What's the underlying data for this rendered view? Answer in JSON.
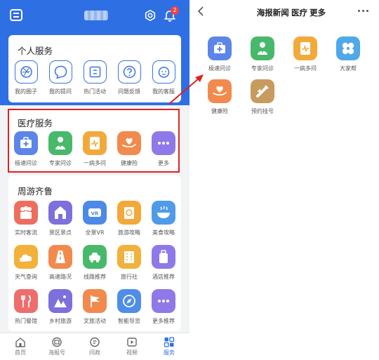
{
  "left_screen": {
    "notification_count": "2",
    "personal_services": {
      "title": "个人服务",
      "items": [
        {
          "label": "我的圈子",
          "icon": "camera-shutter-icon"
        },
        {
          "label": "我的提问",
          "icon": "chat-bubble-icon"
        },
        {
          "label": "热门活动",
          "icon": "ticket-icon"
        },
        {
          "label": "问题反馈",
          "icon": "question-mark-icon"
        },
        {
          "label": "我的客服",
          "icon": "customer-service-icon"
        }
      ]
    },
    "medical_services": {
      "title": "医疗服务",
      "items": [
        {
          "label": "极速问诊",
          "icon": "first-aid-kit-icon",
          "color": "#5b85e8"
        },
        {
          "label": "专家问诊",
          "icon": "doctor-icon",
          "color": "#48b96b"
        },
        {
          "label": "一病多问",
          "icon": "medical-report-icon",
          "color": "#f3a93a"
        },
        {
          "label": "健康险",
          "icon": "hand-heart-icon",
          "color": "#f18a4c"
        },
        {
          "label": "更多",
          "icon": "more-dots-icon",
          "color": "#8f79e8"
        }
      ]
    },
    "tour_services": {
      "title": "周游齐鲁",
      "items": [
        {
          "label": "实时客流",
          "icon": "crowd-icon",
          "color": "#ee6e5e"
        },
        {
          "label": "景区景点",
          "icon": "landmark-icon",
          "color": "#7d6fdc"
        },
        {
          "label": "全景VR",
          "icon": "vr-headset-icon",
          "color": "#4d8ae8"
        },
        {
          "label": "旅游攻略",
          "icon": "guidebook-icon",
          "color": "#f2a93a"
        },
        {
          "label": "美食攻略",
          "icon": "food-bowl-icon",
          "color": "#4f9be8"
        },
        {
          "label": "天气查询",
          "icon": "weather-cloud-icon",
          "color": "#f2b13a"
        },
        {
          "label": "高速路况",
          "icon": "highway-icon",
          "color": "#f18a4c"
        },
        {
          "label": "线路推荐",
          "icon": "route-car-icon",
          "color": "#48b96b"
        },
        {
          "label": "旅行社",
          "icon": "travel-agency-icon",
          "color": "#f2b13a"
        },
        {
          "label": "酒店推荐",
          "icon": "luggage-icon",
          "color": "#8f79e8"
        },
        {
          "label": "热门餐馆",
          "icon": "fork-knife-icon",
          "color": "#ee6e6e"
        },
        {
          "label": "乡村旅游",
          "icon": "village-icon",
          "color": "#7d6fdc"
        },
        {
          "label": "文旅活动",
          "icon": "flag-icon",
          "color": "#f18a4c"
        },
        {
          "label": "智能导览",
          "icon": "compass-icon",
          "color": "#4f8ee8"
        },
        {
          "label": "更多推荐",
          "icon": "more-dots-icon",
          "color": "#8f79e8"
        }
      ]
    },
    "tabbar": [
      {
        "label": "首页",
        "icon": "home-icon"
      },
      {
        "label": "海报号",
        "icon": "poster-icon"
      },
      {
        "label": "问政",
        "icon": "inquiry-icon"
      },
      {
        "label": "视频",
        "icon": "video-icon"
      },
      {
        "label": "服务",
        "icon": "grid-icon"
      }
    ]
  },
  "right_screen": {
    "title": "海报新闻 医疗 更多",
    "items": [
      {
        "label": "极速问诊",
        "icon": "first-aid-kit-icon",
        "color": "#5b85e8"
      },
      {
        "label": "专家问诊",
        "icon": "doctor-icon",
        "color": "#48b96b"
      },
      {
        "label": "一病多问",
        "icon": "medical-report-icon",
        "color": "#f3a93a"
      },
      {
        "label": "大家帮",
        "icon": "four-leaf-icon",
        "color": "#4fa8e8"
      },
      {
        "label": "健康险",
        "icon": "hand-heart-icon",
        "color": "#f18a4c"
      },
      {
        "label": "预约挂号",
        "icon": "syringe-icon",
        "color": "#c99a5e"
      }
    ]
  },
  "colors": {
    "primary_blue": "#2f6fe4",
    "highlight_red": "#e02020",
    "badge_red": "#f04141"
  }
}
